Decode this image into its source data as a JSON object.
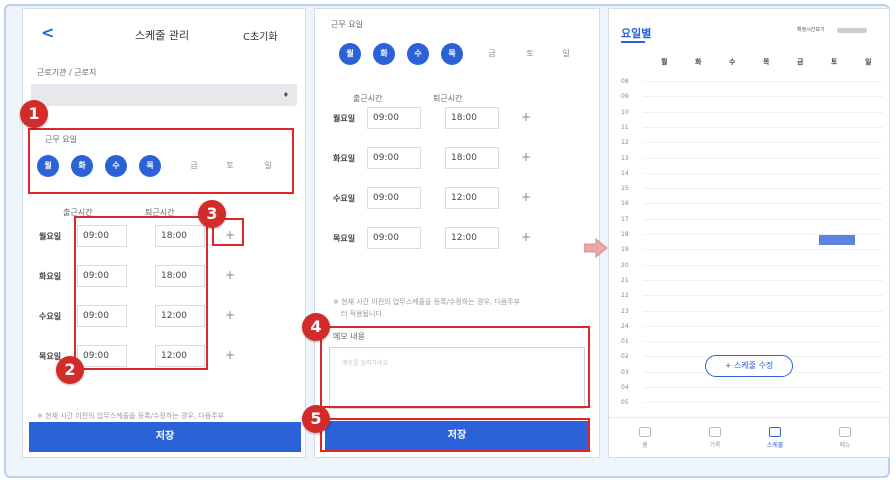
{
  "panel1": {
    "back_glyph": "<",
    "title": "스케줄 관리",
    "reset_label": "C초기화",
    "workplace_label": "근로기관 / 근로지",
    "select_arrow": "♦",
    "workdays_label": "근무 요일",
    "days": [
      {
        "label": "월",
        "on": true
      },
      {
        "label": "화",
        "on": true
      },
      {
        "label": "수",
        "on": true
      },
      {
        "label": "목",
        "on": true
      },
      {
        "label": "금",
        "on": false
      },
      {
        "label": "토",
        "on": false
      },
      {
        "label": "일",
        "on": false
      }
    ],
    "start_header": "출근시간",
    "end_header": "퇴근시간",
    "rows": [
      {
        "day": "월요일",
        "start": "09:00",
        "end": "18:00"
      },
      {
        "day": "화요일",
        "start": "09:00",
        "end": "18:00"
      },
      {
        "day": "수요일",
        "start": "09:00",
        "end": "12:00"
      },
      {
        "day": "목요일",
        "start": "09:00",
        "end": "12:00"
      }
    ],
    "notice": "※ 현재 시간 이전의 업무스케줄을 등록/수정하는 경우, 다음주부",
    "save_label": "저장"
  },
  "panel2": {
    "workdays_label": "근무 요일",
    "days": [
      {
        "label": "월",
        "on": true
      },
      {
        "label": "화",
        "on": true
      },
      {
        "label": "수",
        "on": true
      },
      {
        "label": "목",
        "on": true
      },
      {
        "label": "금",
        "on": false
      },
      {
        "label": "토",
        "on": false
      },
      {
        "label": "일",
        "on": false
      }
    ],
    "start_header": "출근시간",
    "end_header": "퇴근시간",
    "rows": [
      {
        "day": "월요일",
        "start": "09:00",
        "end": "18:00"
      },
      {
        "day": "화요일",
        "start": "09:00",
        "end": "18:00"
      },
      {
        "day": "수요일",
        "start": "09:00",
        "end": "12:00"
      },
      {
        "day": "목요일",
        "start": "09:00",
        "end": "12:00"
      }
    ],
    "notice_line1": "※ 현재 시간 이전의 업무스케줄을 등록/수정하는 경우, 다음주부",
    "notice_line2": "터 적용됩니다.",
    "memo_label": "메모 내용",
    "memo_placeholder": "메모를 입력하세요",
    "save_label": "저장"
  },
  "panel3": {
    "title": "요일별",
    "top_right": "확정시간보기",
    "day_headers": [
      "월",
      "화",
      "수",
      "목",
      "금",
      "토",
      "일"
    ],
    "hours": [
      "08",
      "09",
      "10",
      "11",
      "12",
      "13",
      "14",
      "15",
      "16",
      "17",
      "18",
      "19",
      "20",
      "21",
      "22",
      "23",
      "24",
      "01",
      "02",
      "03",
      "04",
      "05"
    ],
    "edit_button": "+ 스케줄 수정",
    "nav": [
      {
        "label": "홈",
        "active": false
      },
      {
        "label": "기록",
        "active": false
      },
      {
        "label": "스케줄",
        "active": true
      },
      {
        "label": "메뉴",
        "active": false
      }
    ]
  },
  "badges": [
    "1",
    "2",
    "3",
    "4",
    "5"
  ],
  "colors": {
    "accent": "#2b62d8",
    "highlight": "#e0262b",
    "badge": "#d32a2a"
  }
}
